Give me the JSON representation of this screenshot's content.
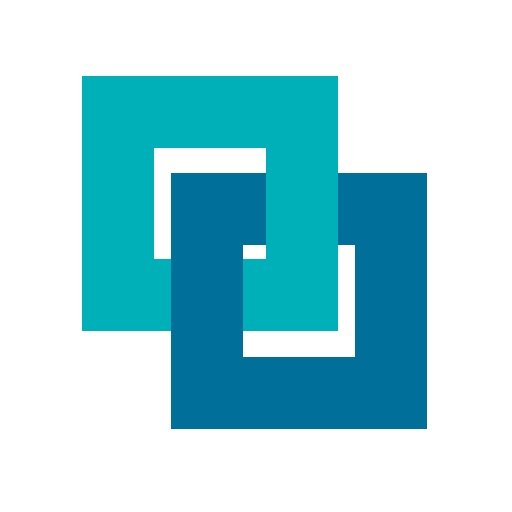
{
  "icon": {
    "name": "interlocking-squares-icon",
    "colors": {
      "background": "#ffffff",
      "front_square": "#00b0b8",
      "back_square": "#006f9a"
    }
  }
}
